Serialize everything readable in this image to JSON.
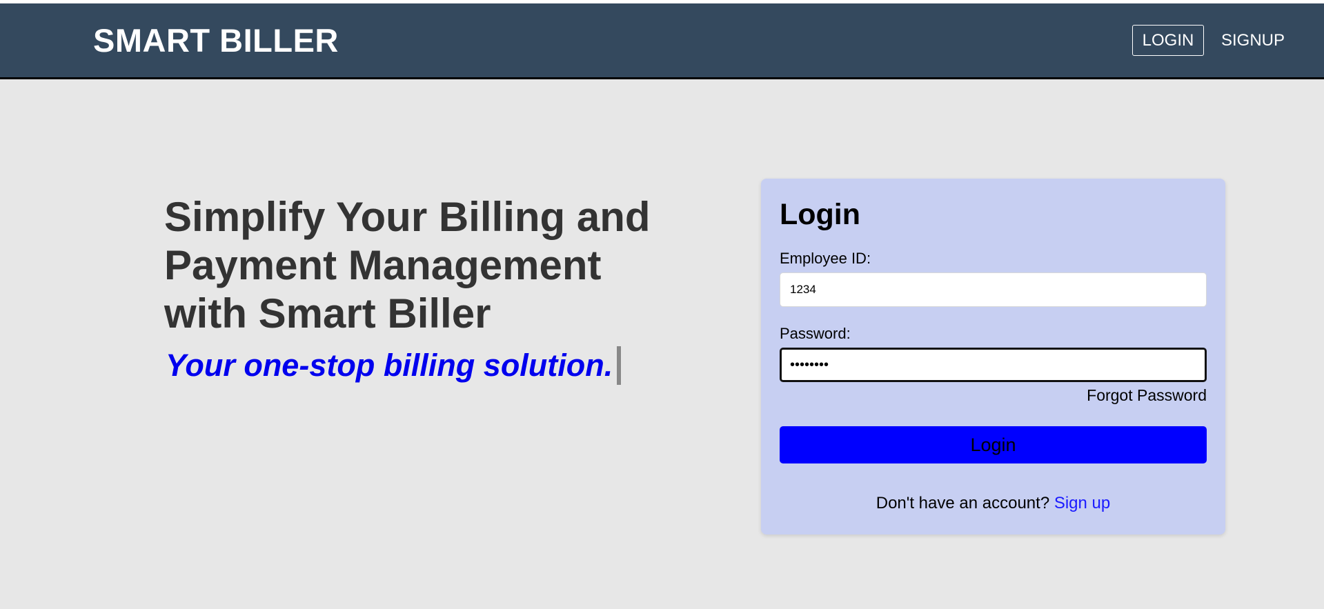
{
  "navbar": {
    "brand": "SMART BILLER",
    "login_label": "LOGIN",
    "signup_label": "SIGNUP"
  },
  "hero": {
    "title": "Simplify Your Billing and Payment Management with Smart Biller",
    "tagline": "Your one-stop billing solution."
  },
  "login_form": {
    "title": "Login",
    "employee_id_label": "Employee ID:",
    "employee_id_value": "1234",
    "password_label": "Password:",
    "password_value": "abcd1234",
    "forgot_password_label": "Forgot Password",
    "submit_label": "Login",
    "signup_prompt": "Don't have an account?",
    "signup_link_label": "Sign up"
  },
  "colors": {
    "navbar_bg": "#34495e",
    "page_bg": "#e7e7e7",
    "card_bg": "#c7cff2",
    "accent_button": "#0000ff",
    "tagline": "#0000ee",
    "link": "#1a1aff"
  }
}
